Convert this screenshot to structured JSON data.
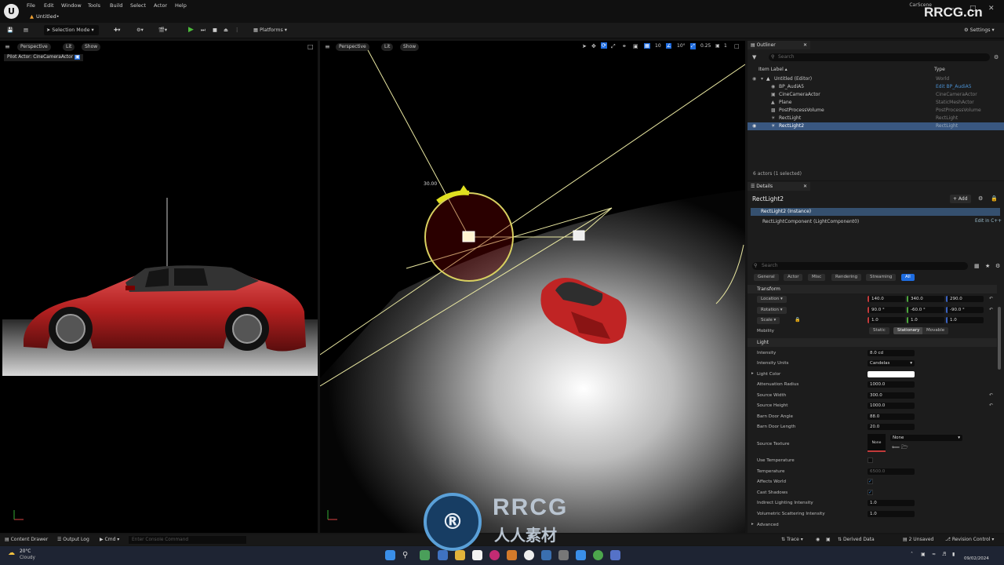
{
  "menubar": {
    "items": [
      "File",
      "Edit",
      "Window",
      "Tools",
      "Build",
      "Select",
      "Actor",
      "Help"
    ],
    "doc_tab": "Untitled•",
    "project": "CarScene"
  },
  "toolbar": {
    "mode": "Selection Mode",
    "platforms": "Platforms",
    "settings": "Settings"
  },
  "viewport_left": {
    "perspective": "Perspective",
    "lit": "Lit",
    "show": "Show",
    "pilot": "Pilot Actor: CineCameraActor"
  },
  "viewport_right": {
    "perspective": "Perspective",
    "lit": "Lit",
    "show": "Show",
    "grid_snap": "10",
    "rot_snap": "10°",
    "scale_snap": "0.25",
    "cam_speed": "1",
    "angle_readout": "30.00"
  },
  "outliner": {
    "tab": "Outliner",
    "search_placeholder": "Search",
    "col_label": "Item Label ▴",
    "col_type": "Type",
    "rows": [
      {
        "label": "Untitled (Editor)",
        "type": "World"
      },
      {
        "label": "BP_AudiA5",
        "type": "Edit BP_AudiA5"
      },
      {
        "label": "CineCameraActor",
        "type": "CineCameraActor"
      },
      {
        "label": "Plane",
        "type": "StaticMeshActor"
      },
      {
        "label": "PostProcessVolume",
        "type": "PostProcessVolume"
      },
      {
        "label": "RectLight",
        "type": "RectLight"
      },
      {
        "label": "RectLight2",
        "type": "RectLight"
      }
    ],
    "status": "6 actors (1 selected)"
  },
  "details": {
    "tab": "Details",
    "actor_name": "RectLight2",
    "add": "+ Add",
    "instance": "RectLight2 (Instance)",
    "component": "RectLightComponent (LightComponent0)",
    "edit_cpp": "Edit in C++",
    "search_placeholder": "Search",
    "filters": [
      "General",
      "Actor",
      "Misc",
      "Rendering",
      "Streaming",
      "All"
    ],
    "transform_head": "Transform",
    "location": {
      "label": "Location",
      "x": "140.0",
      "y": "340.0",
      "z": "290.0"
    },
    "rotation": {
      "label": "Rotation",
      "x": "90.0 °",
      "y": "-60.0 °",
      "z": "-90.0 °"
    },
    "scale": {
      "label": "Scale",
      "x": "1.0",
      "y": "1.0",
      "z": "1.0"
    },
    "mobility": {
      "label": "Mobility",
      "options": [
        "Static",
        "Stationary",
        "Movable"
      ]
    },
    "light_head": "Light",
    "intensity": {
      "label": "Intensity",
      "value": "8.0 cd"
    },
    "intensity_units": {
      "label": "Intensity Units",
      "value": "Candelas"
    },
    "light_color": {
      "label": "Light Color"
    },
    "attenuation": {
      "label": "Attenuation Radius",
      "value": "1000.0"
    },
    "source_width": {
      "label": "Source Width",
      "value": "300.0"
    },
    "source_height": {
      "label": "Source Height",
      "value": "1000.0"
    },
    "barn_angle": {
      "label": "Barn Door Angle",
      "value": "88.0"
    },
    "barn_length": {
      "label": "Barn Door Length",
      "value": "20.0"
    },
    "source_texture": {
      "label": "Source Texture",
      "thumb": "None",
      "value": "None"
    },
    "use_temperature": {
      "label": "Use Temperature"
    },
    "temperature": {
      "label": "Temperature",
      "value": "6500.0"
    },
    "affects_world": {
      "label": "Affects World"
    },
    "cast_shadows": {
      "label": "Cast Shadows"
    },
    "indirect": {
      "label": "Indirect Lighting Intensity",
      "value": "1.0"
    },
    "volumetric": {
      "label": "Volumetric Scattering Intensity",
      "value": "1.0"
    },
    "advanced": "Advanced"
  },
  "bottombar": {
    "content_drawer": "Content Drawer",
    "output_log": "Output Log",
    "cmd": "Cmd",
    "console_placeholder": "Enter Console Command",
    "trace": "Trace",
    "derived_data": "Derived Data",
    "unsaved": "2 Unsaved",
    "revision": "Revision Control"
  },
  "taskbar": {
    "weather_temp": "20°C",
    "weather_text": "Cloudy",
    "date": "09/02/2024"
  },
  "watermark": {
    "top": "RRCG.cn",
    "brand": "RRCG",
    "chinese": "人人素材"
  }
}
